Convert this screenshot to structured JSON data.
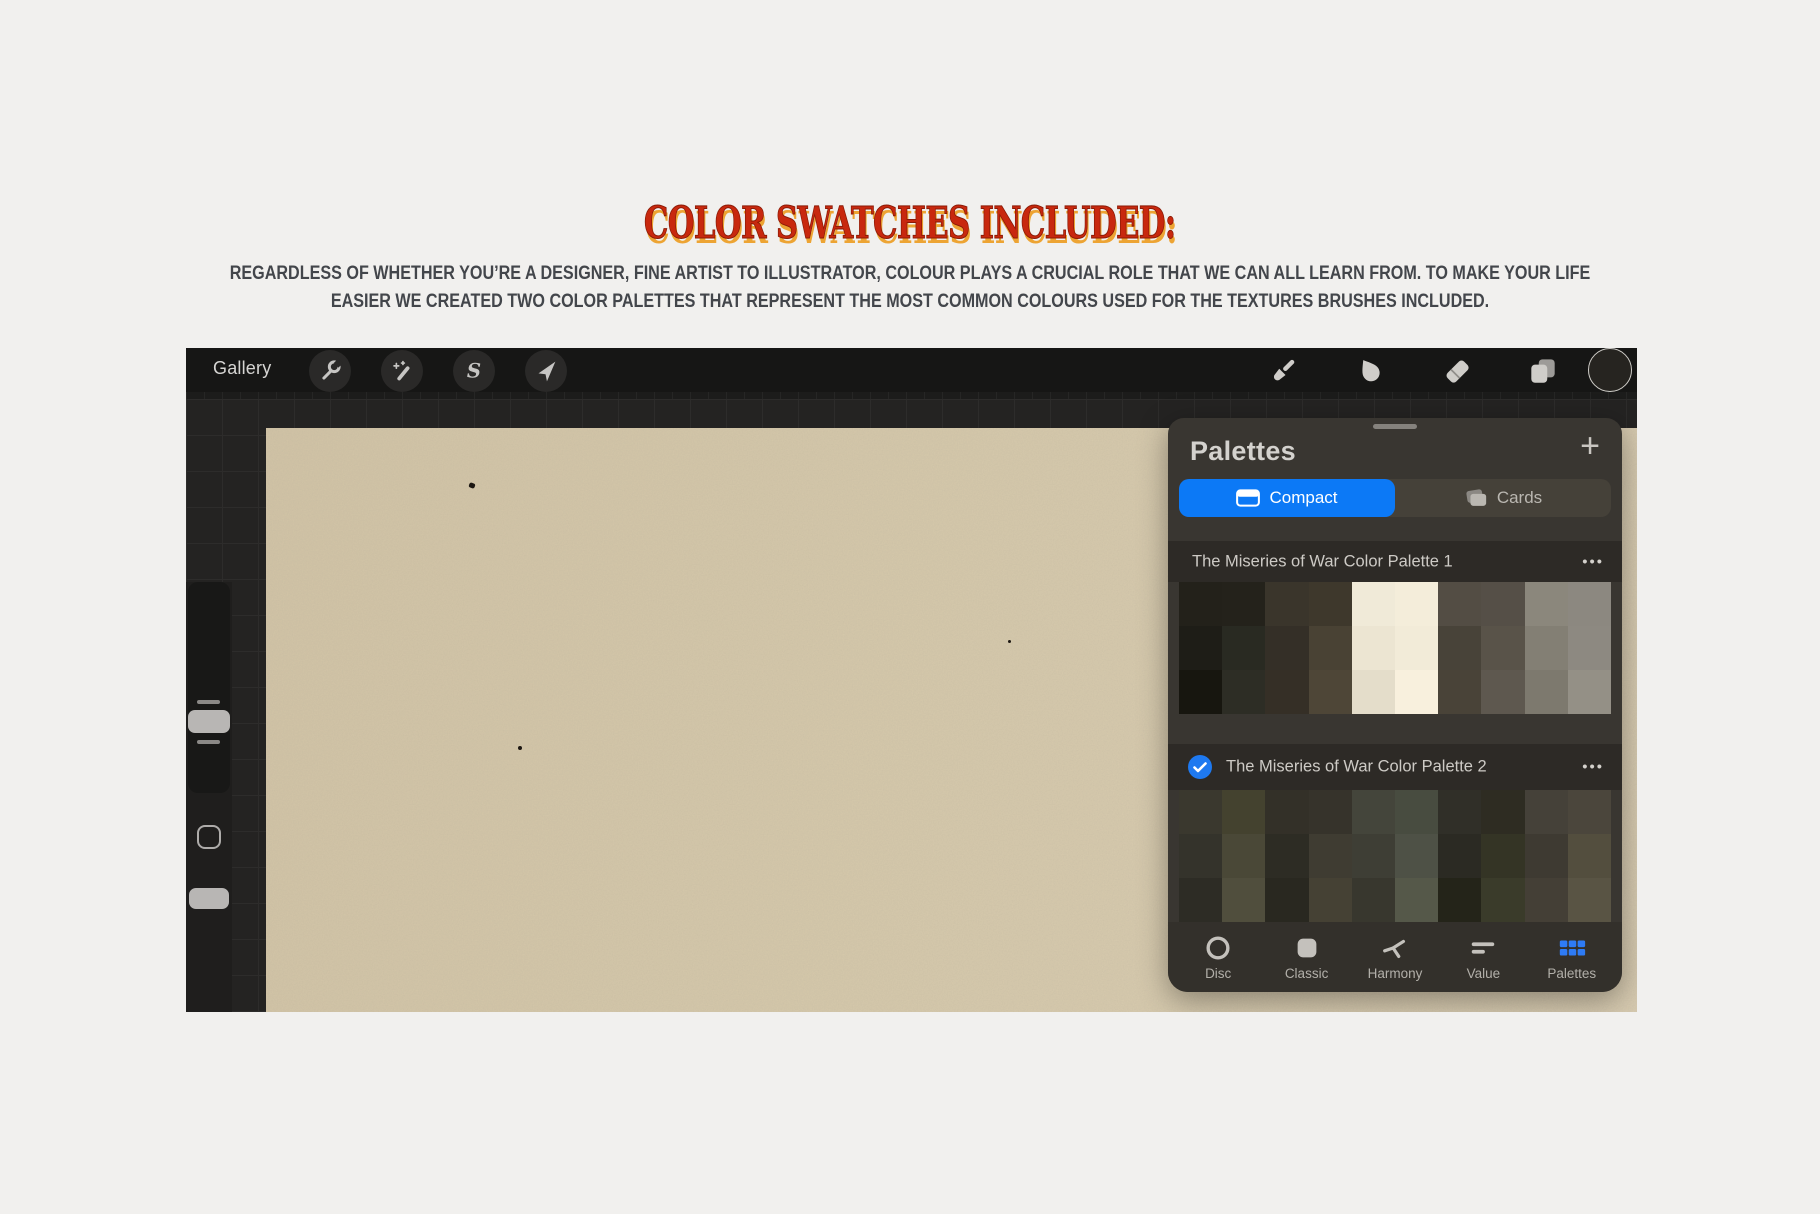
{
  "header": {
    "title": "COLOR SWATCHES INCLUDED:",
    "title_color": "#c8280e",
    "title_shadow_color": "#eda433",
    "body_line1": "REGARDLESS OF WHETHER YOU’RE A DESIGNER, FINE ARTIST TO ILLUSTRATOR, COLOUR PLAYS A CRUCIAL ROLE THAT WE CAN ALL LEARN FROM. TO MAKE YOUR LIFE",
    "body_line2": "EASIER WE CREATED TWO COLOR PALETTES THAT REPRESENT THE MOST COMMON COLOURS USED FOR THE TEXTURES BRUSHES INCLUDED.",
    "body_color": "#43464b"
  },
  "app": {
    "toolbar": {
      "gallery_label": "Gallery",
      "left_icons": [
        "wrench",
        "magic-wand",
        "selection-s",
        "transform-arrow"
      ],
      "right_icons": [
        "paint-brush",
        "smudge-finger",
        "eraser",
        "layers",
        "active-color-circle"
      ]
    },
    "canvas": {
      "paper_color": "#d6c9ab"
    },
    "palettes_panel": {
      "title": "Palettes",
      "add_label": "+",
      "accent_blue": "#0c79f6",
      "check_blue": "#1e79f0",
      "view_tabs": [
        {
          "label": "Compact",
          "selected": true
        },
        {
          "label": "Cards",
          "selected": false
        }
      ],
      "palettes": [
        {
          "name": "The Miseries of War Color Palette 1",
          "selected": false,
          "menu": "•••",
          "swatches": [
            [
              "#23211a",
              "#24221b",
              "#3a352b",
              "#3e382c",
              "#f0ead8",
              "#f4edda",
              "#534d44",
              "#554f47",
              "#8b877c",
              "#8c8880"
            ],
            [
              "#1e1d17",
              "#292a22",
              "#342f27",
              "#494234",
              "#ece5d2",
              "#f2ebd8",
              "#484339",
              "#595349",
              "#837f74",
              "#8d8981"
            ],
            [
              "#17160f",
              "#2d2d25",
              "#352f26",
              "#4e4637",
              "#e4ddca",
              "#f8f0dd",
              "#494338",
              "#5e584f",
              "#7d796e",
              "#949086"
            ]
          ]
        },
        {
          "name": "The Miseries of War Color Palette 2",
          "selected": true,
          "menu": "•••",
          "swatches": [
            [
              "#3a382e",
              "#44422f",
              "#333028",
              "#36332b",
              "#44453b",
              "#484c40",
              "#302f28",
              "#2e2c22",
              "#454139",
              "#4b463c"
            ],
            [
              "#34332b",
              "#4a4837",
              "#2d2c24",
              "#3f3c32",
              "#3e3e35",
              "#4e5146",
              "#2b2a23",
              "#343425",
              "#3e3a32",
              "#534e3e"
            ],
            [
              "#2d2c25",
              "#504e3d",
              "#292820",
              "#454134",
              "#38372e",
              "#555849",
              "#242419",
              "#3a3b2a",
              "#443f36",
              "#595444"
            ]
          ]
        }
      ],
      "bottom_tabs": [
        {
          "label": "Disc",
          "selected": false
        },
        {
          "label": "Classic",
          "selected": false
        },
        {
          "label": "Harmony",
          "selected": false
        },
        {
          "label": "Value",
          "selected": false
        },
        {
          "label": "Palettes",
          "selected": true
        }
      ]
    }
  }
}
